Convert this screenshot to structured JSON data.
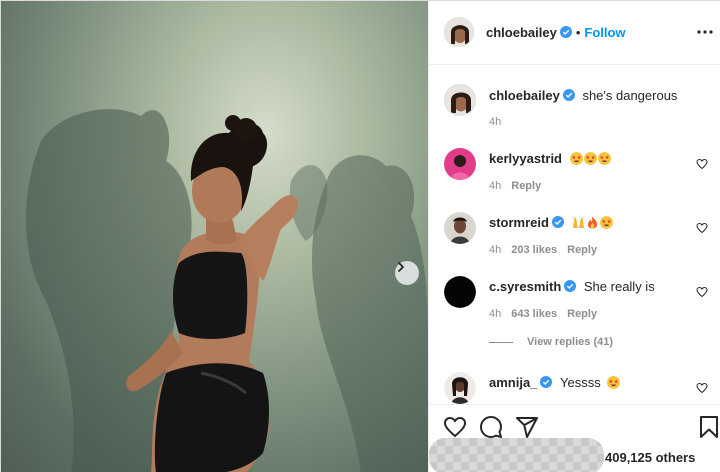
{
  "header": {
    "username": "chloebailey",
    "separator": "•",
    "follow_label": "Follow"
  },
  "caption": {
    "username": "chloebailey",
    "text": "she's dangerous",
    "time": "4h"
  },
  "comments": [
    {
      "username": "kerlyyastrid",
      "text": "",
      "emojis": [
        "star-struck",
        "star-struck",
        "star-struck"
      ],
      "time": "4h",
      "likes": "",
      "reply_label": "Reply",
      "verified": false
    },
    {
      "username": "stormreid",
      "text": "",
      "emojis": [
        "raising-hands",
        "fire",
        "star-struck"
      ],
      "time": "4h",
      "likes": "203 likes",
      "reply_label": "Reply",
      "verified": true
    },
    {
      "username": "c.syresmith",
      "text": "She really is",
      "emojis": [],
      "time": "4h",
      "likes": "643 likes",
      "reply_label": "Reply",
      "verified": true
    },
    {
      "username": "amnija_",
      "text": "Yessss",
      "emojis": [
        "star-struck"
      ],
      "time": "",
      "likes": "",
      "reply_label": "",
      "verified": true
    }
  ],
  "view_replies": "View replies (41)",
  "footer": {
    "likes_text": "409,125 others"
  },
  "colors": {
    "accent": "#0095f6",
    "text": "#262626",
    "muted": "#8e8e8e",
    "verified": "#3897f0",
    "emoji_yellow": "#f7c33b"
  },
  "icons": {
    "more": "more-horizontal-icon",
    "heart": "heart-outline-icon",
    "comment": "comment-icon",
    "share": "paper-plane-icon",
    "save": "bookmark-icon",
    "next": "chevron-right-icon"
  }
}
